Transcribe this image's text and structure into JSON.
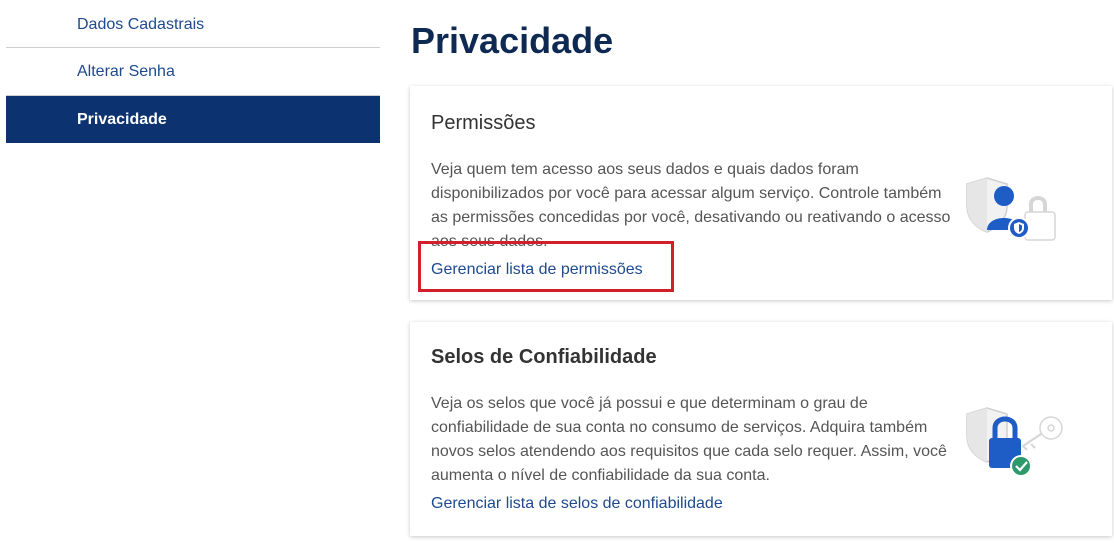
{
  "sidebar": {
    "items": [
      {
        "label": "Dados Cadastrais",
        "active": false
      },
      {
        "label": "Alterar Senha",
        "active": false
      },
      {
        "label": "Privacidade",
        "active": true
      }
    ]
  },
  "main": {
    "title": "Privacidade",
    "cards": [
      {
        "title": "Permissões",
        "description": "Veja quem tem acesso aos seus dados e quais dados foram disponibilizados por você para acessar algum serviço. Controle também as permissões concedidas por você, desativando ou reativando o acesso aos seus dados.",
        "link": "Gerenciar lista de permissões",
        "icon": "user-shield-lock-icon"
      },
      {
        "title": "Selos de Confiabilidade",
        "description": "Veja os selos que você já possui e que determinam o grau de confiabilidade de sua conta no consumo de serviços. Adquira também novos selos atendendo aos requisitos que cada selo requer. Assim, você aumenta o nível de confiabilidade da sua conta.",
        "link": "Gerenciar lista de selos de confiabilidade",
        "icon": "lock-key-check-icon"
      }
    ]
  },
  "colors": {
    "primary_dark": "#0c326f",
    "link": "#1e4a8f",
    "title": "#0e2a52",
    "highlight": "#d11f2c",
    "check": "#2e9a6b"
  }
}
